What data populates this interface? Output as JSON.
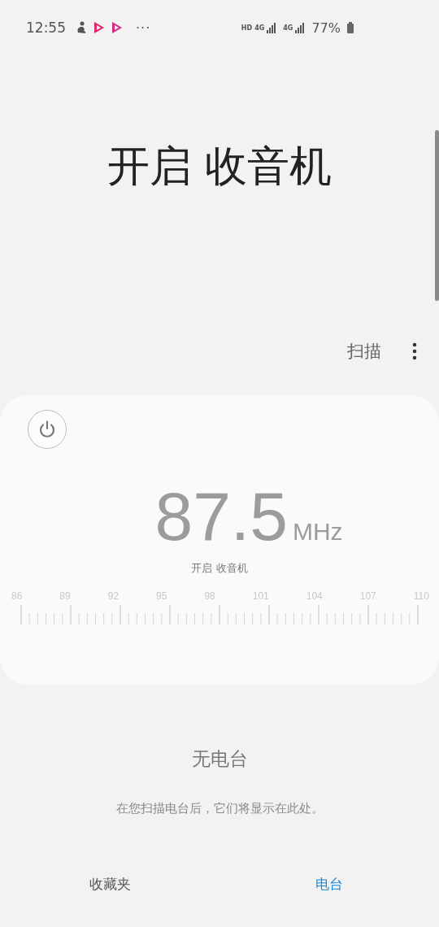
{
  "status_bar": {
    "time": "12:55",
    "more": "···",
    "hd": "HD",
    "network_1": "4G",
    "network_2": "4G",
    "battery": "77%"
  },
  "title": "开启 收音机",
  "toolbar": {
    "scan": "扫描"
  },
  "tuner": {
    "power_on": false,
    "frequency": "87.5",
    "unit": "MHz",
    "station": "开启 收音机",
    "scale_labels": [
      "86",
      "89",
      "92",
      "95",
      "98",
      "101",
      "104",
      "107",
      "110"
    ]
  },
  "empty_state": {
    "title": "无电台",
    "message": "在您扫描电台后，它们将显示在此处。"
  },
  "tabs": [
    {
      "label": "收藏夹",
      "selected": false
    },
    {
      "label": "电台",
      "selected": true
    }
  ]
}
